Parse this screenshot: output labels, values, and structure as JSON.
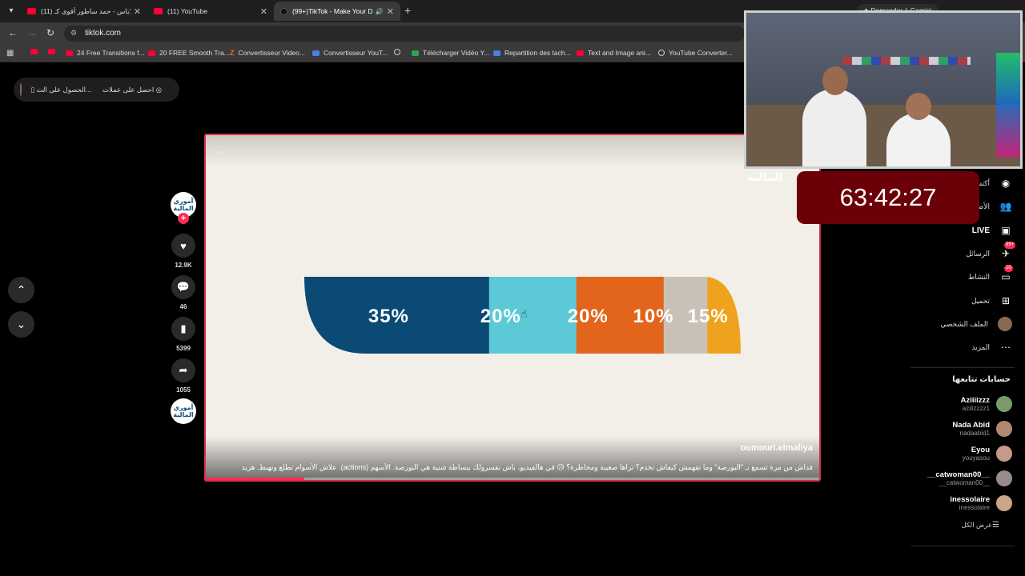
{
  "tabs": [
    {
      "title": "لاباس - حمد ساطور أقوى كـ (11)",
      "type": "yt",
      "active": false
    },
    {
      "title": "(11) YouTube",
      "type": "yt",
      "active": false
    },
    {
      "title": "(99+)TikTok - Make Your Da",
      "type": "tt",
      "active": true
    }
  ],
  "gemini_label": "Demander à Gemini",
  "url": "tiktok.com",
  "bookmarks": [
    "24 Free Transitions f...",
    "20 FREE Smooth Tra...",
    "Convertisseur Video...",
    "Convertisseur YouT...",
    "Télécharger Vidéo Y...",
    "Repartition des tach...",
    "Text and Image ani...",
    "YouTube Converter..."
  ],
  "top_pill": {
    "item1": "الحصول على الت...",
    "item2": "احصل على عملات"
  },
  "video": {
    "dots": "...",
    "watermark": "المالية",
    "author": "oumouri.elmaliya",
    "caption": "فداش من مرة تسمع بـ \"البورصة\" وما تفهمش كيفاش تخدم؟ تراها صعيبة ومخاطرة؟ 😥 في هالفيديو، باش نفسرولك ببساطة شنية هي البورصة. الأسهم (actions). علاش الأسوام تطلع وتهبط.  هزيد",
    "progress": 0.16
  },
  "chart_data": {
    "type": "bar",
    "categories": [
      "35%",
      "20%",
      "20%",
      "10%",
      "15%"
    ],
    "values": [
      35,
      20,
      20,
      10,
      15
    ],
    "colors": [
      "#0a4a75",
      "#5ccad6",
      "#e2651b",
      "#c9c1b8",
      "#efa21d"
    ]
  },
  "actions": {
    "creator_badge": "أموري المالية",
    "likes": "12.9K",
    "comments": "46",
    "saves": "5399",
    "shares": "1055"
  },
  "timer": "63:42:27",
  "sidebar": {
    "explore": "أكتشف",
    "following": "الأصدقاء",
    "live": "LIVE",
    "messages": "الرسائل",
    "messages_badge": "99+",
    "activity": "النشاط",
    "activity_badge": "10",
    "upload": "تحميل",
    "profile": "الملف الشخصي",
    "more": "المزيد"
  },
  "following_title": "حسابات تتابعها",
  "accounts": [
    {
      "name": "Aziiiizzz",
      "user": "aziiizzzz1",
      "color": "#7a9a6a"
    },
    {
      "name": "Nada Abid",
      "user": "nadaabid1",
      "color": "#b08a70"
    },
    {
      "name": "Eyou",
      "user": "youyasou",
      "color": "#c79a88"
    },
    {
      "name": "__catwoman00__",
      "user": "__catwoman00__",
      "color": "#9a8a8a"
    },
    {
      "name": "inessolaire",
      "user": "inessolaire",
      "color": "#caa58a"
    }
  ],
  "see_all": "عرض الكل"
}
